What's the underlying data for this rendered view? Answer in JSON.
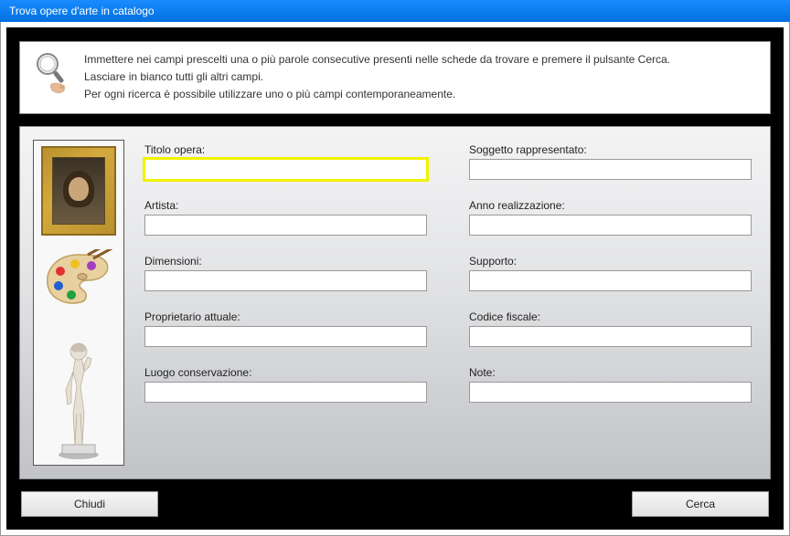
{
  "window": {
    "title": "Trova opere d'arte in catalogo"
  },
  "help": {
    "line1": "Immettere nei campi prescelti una o più parole consecutive presenti nelle schede da trovare e premere il pulsante Cerca.",
    "line2": "Lasciare in bianco tutti gli altri campi.",
    "line3": "Per ogni ricerca è possibile utilizzare uno o più campi contemporaneamente."
  },
  "fields": {
    "titolo_opera": {
      "label": "Titolo opera:",
      "value": ""
    },
    "soggetto": {
      "label": "Soggetto rappresentato:",
      "value": ""
    },
    "artista": {
      "label": "Artista:",
      "value": ""
    },
    "anno": {
      "label": "Anno realizzazione:",
      "value": ""
    },
    "dimensioni": {
      "label": "Dimensioni:",
      "value": ""
    },
    "supporto": {
      "label": "Supporto:",
      "value": ""
    },
    "proprietario": {
      "label": "Proprietario attuale:",
      "value": ""
    },
    "codice_fiscale": {
      "label": "Codice fiscale:",
      "value": ""
    },
    "luogo": {
      "label": "Luogo conservazione:",
      "value": ""
    },
    "note": {
      "label": "Note:",
      "value": ""
    }
  },
  "buttons": {
    "close": "Chiudi",
    "search": "Cerca"
  },
  "sidebar_icons": {
    "painting": "mona-lisa",
    "palette": "painter-palette",
    "statue": "david-statue"
  }
}
